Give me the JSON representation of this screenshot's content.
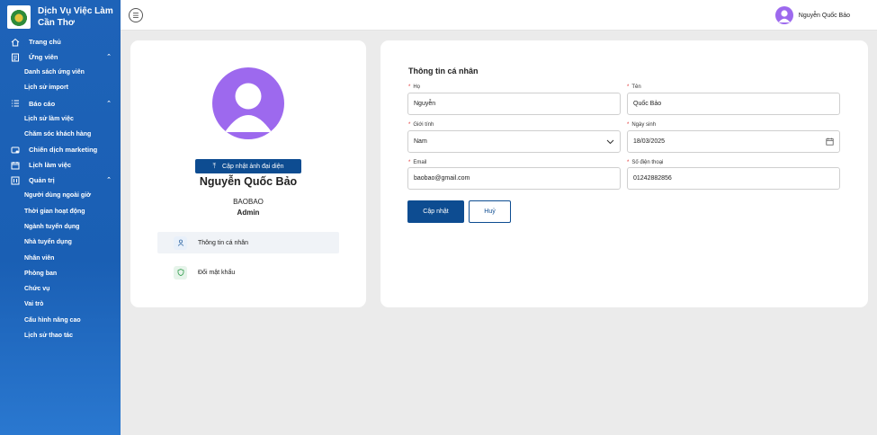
{
  "app": {
    "title_line1": "Dịch Vụ Việc Làm",
    "title_line2": "Cần Thơ"
  },
  "sidebar": {
    "items": [
      {
        "label": "Trang chủ",
        "icon": "home-icon"
      },
      {
        "label": "Ứng viên",
        "icon": "document-list-icon",
        "expanded": true
      },
      {
        "label": "Danh sách ứng viên",
        "sub": true
      },
      {
        "label": "Lịch sử import",
        "sub": true
      },
      {
        "label": "Báo cáo",
        "icon": "list-icon",
        "expanded": true
      },
      {
        "label": "Lịch sử làm việc",
        "sub": true
      },
      {
        "label": "Chăm sóc khách hàng",
        "sub": true
      },
      {
        "label": "Chiến dịch marketing",
        "icon": "campaign-icon"
      },
      {
        "label": "Lịch làm việc",
        "icon": "calendar-icon"
      },
      {
        "label": "Quản trị",
        "icon": "admin-icon",
        "expanded": true
      },
      {
        "label": "Người dùng ngoài giờ",
        "sub": true
      },
      {
        "label": "Thời gian hoạt động",
        "sub": true
      },
      {
        "label": "Ngành tuyển dụng",
        "sub": true
      },
      {
        "label": "Nhà tuyển dụng",
        "sub": true
      },
      {
        "label": "Nhân viên",
        "sub": true
      },
      {
        "label": "Phòng ban",
        "sub": true
      },
      {
        "label": "Chức vụ",
        "sub": true
      },
      {
        "label": "Vai trò",
        "sub": true
      },
      {
        "label": "Cấu hình nâng cao",
        "sub": true
      },
      {
        "label": "Lịch sử thao tác",
        "sub": true
      }
    ]
  },
  "header": {
    "user_name": "Nguyễn Quốc Bảo"
  },
  "profile": {
    "upload_label": "Cập nhật ảnh đại diện",
    "full_name": "Nguyễn Quốc Bảo",
    "username": "BAOBAO",
    "role": "Admin",
    "menu": [
      {
        "label": "Thông tin cá nhân",
        "icon": "user-icon",
        "active": true
      },
      {
        "label": "Đổi mật khẩu",
        "icon": "shield-icon",
        "active": false
      }
    ]
  },
  "form": {
    "title": "Thông tin cá nhân",
    "last_name": {
      "label": "Họ",
      "value": "Nguyễn"
    },
    "first_name": {
      "label": "Tên",
      "value": "Quốc Bảo"
    },
    "gender": {
      "label": "Giới tính",
      "value": "Nam"
    },
    "dob": {
      "label": "Ngày sinh",
      "value": "18/03/2025"
    },
    "email": {
      "label": "Email",
      "value": "baobao@gmail.com"
    },
    "phone": {
      "label": "Số điện thoại",
      "value": "01242882856"
    },
    "save_label": "Cập nhật",
    "cancel_label": "Huỷ"
  },
  "colors": {
    "primary": "#0d4c91",
    "sidebar": "#1a5fb4",
    "avatar": "#9d69ee",
    "required": "#e03030"
  }
}
